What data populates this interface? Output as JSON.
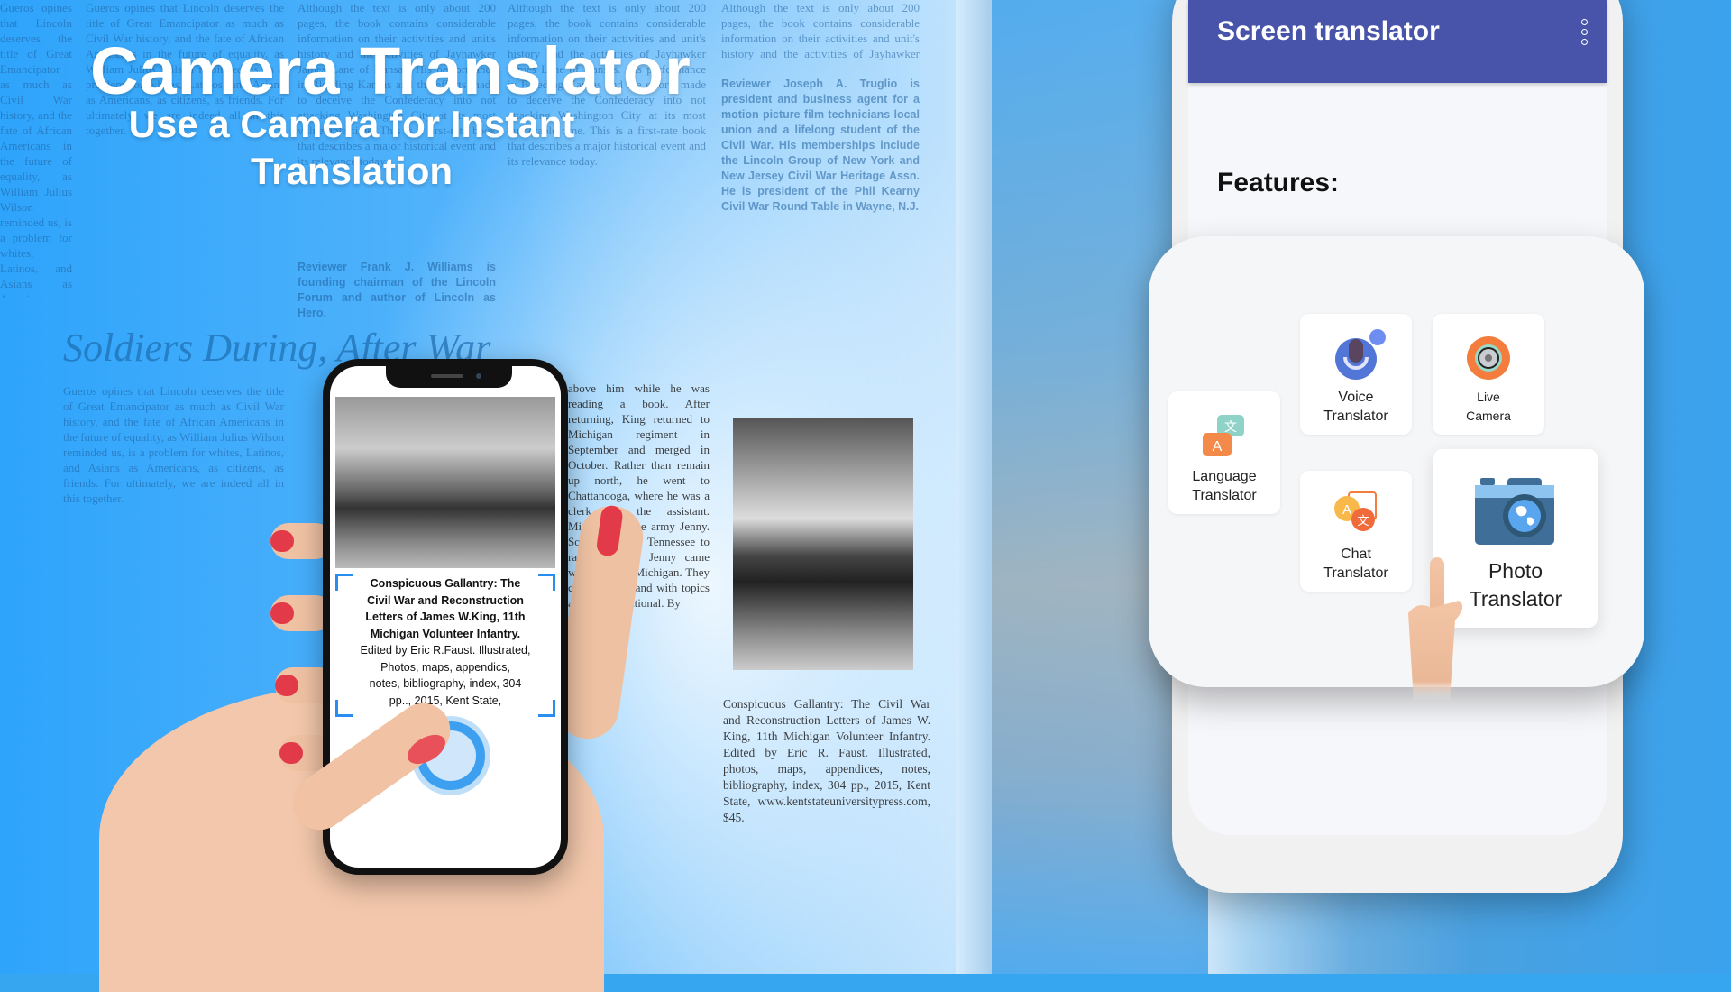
{
  "hero": {
    "title": "Camera Translator",
    "subtitle_line1": "Use a Camera for Instant",
    "subtitle_line2": "Translation"
  },
  "background_newspaper": {
    "headline": "Soldiers During, After War",
    "reviewer_truglio": "Reviewer Joseph A. Truglio is president and business agent for a motion picture film technicians local union and a lifelong student of the Civil War. His memberships include the Lincoln Group of New York and New Jersey Civil War Heritage Assn. He is president of the Phil Kearny Civil War Round Table in Wayne, N.J.",
    "reviewer_williams": "Reviewer Frank J. Williams is founding chairman of the Lincoln Forum and author of Lincoln as Hero.",
    "column_mid": "above him while he was reading a book. After returning, King returned to Michigan regiment in September and merged in October. Rather than remain up north, he went to Chattanooga, where he was a clerk for the assistant. Michigan in the army Jenny. Soon settled in Tennessee to raising cotton. Jenny came with him and Michigan. They corresponded and with topics and special national. By",
    "book_citation": "Conspicuous Gallantry: The Civil War and Reconstruction Letters of James W. King, 11th Michigan Volunteer Infantry. Edited by Eric R. Faust. Illustrated, photos, maps, appendices, notes, bibliography, index, 304 pp., 2015, Kent State, www.kentstateuniversitypress.com, $45.",
    "column_left_top": "Gueros opines that Lincoln deserves the title of Great Emancipator as much as Civil War history, and the fate of African Americans in the future of equality, as William Julius Wilson reminded us, is a problem for whites, Latinos, and Asians as Americans, as citizens, as friends. For ultimately, we are indeed all in this together.",
    "column_mid_top": "Although the text is only about 200 pages, the book contains considerable information on their activities and unit's history and the activities of Jayhawker James Lane of Kansas. His performance in Bleeding Kansas and the efforts made to deceive the Confederacy into not attacking Washington City at its most vulnerable time. This is a first-rate book that describes a major historical event and its relevance today."
  },
  "left_phone": {
    "scanned_text_bold": [
      "Conspicuous Gallantry: The",
      "Civil War and Reconstruction",
      "Letters of James W.King, 11th",
      "Michigan Volunteer Infantry."
    ],
    "scanned_text_regular": [
      "Edited by Eric R.Faust. Illustrated,",
      "Photos, maps, appendics,",
      "notes, bibliography, index, 304",
      "pp.., 2015, Kent State,"
    ],
    "accent_color": "#3d9ff0"
  },
  "right_phone": {
    "app_title": "Screen translator",
    "section_title": "Features:",
    "appbar_color": "#4754a9",
    "features": [
      {
        "label_line1": "Language",
        "label_line2": "Translator",
        "icon": "language-translate-icon"
      },
      {
        "label_line1": "Voice",
        "label_line2": "Translator",
        "icon": "microphone-icon"
      },
      {
        "label_line1": "Live",
        "label_line2": "Camera",
        "icon": "camera-lens-icon"
      },
      {
        "label_line1": "Chat",
        "label_line2": "Translator",
        "icon": "chat-translate-icon"
      },
      {
        "label_line1": "Photo",
        "label_line2": "Translator",
        "icon": "photo-camera-globe-icon"
      }
    ]
  }
}
